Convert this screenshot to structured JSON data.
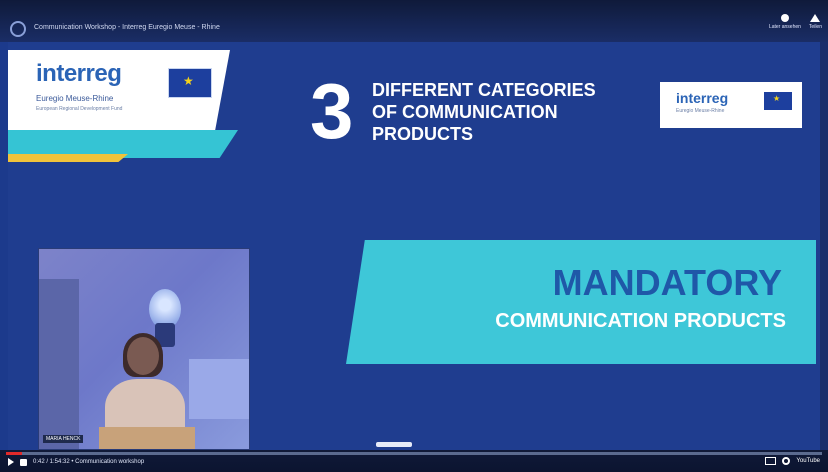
{
  "video": {
    "title": "Communication Workshop - Interreg Euregio Meuse - Rhine",
    "top_right": {
      "watch_later": "Later ansehen",
      "share": "Teilen"
    },
    "progress_percent": 2,
    "time": "0:42 / 1:54:32 • Communication workshop",
    "settings_label": "",
    "yt_label": "YouTube"
  },
  "left_panel": {
    "logo": {
      "brand": "interreg",
      "line1": "Euregio Meuse-Rhine",
      "line2": "European Regional Development Fund"
    },
    "speaker_label": "MARIA HENCK"
  },
  "slide": {
    "number": "3",
    "heading_lines": [
      "DIFFERENT CATEGORIES",
      "OF COMMUNICATION",
      "PRODUCTS"
    ],
    "logo": {
      "brand": "interreg",
      "sub": "Euregio Meuse-Rhine"
    },
    "banner": {
      "title": "MANDATORY",
      "subtitle": "COMMUNICATION PRODUCTS"
    }
  },
  "colors": {
    "accent_teal": "#3ec7d8",
    "accent_yellow": "#f1c33b",
    "brand_blue": "#1f3d8f",
    "progress_red": "#e12a2a"
  }
}
